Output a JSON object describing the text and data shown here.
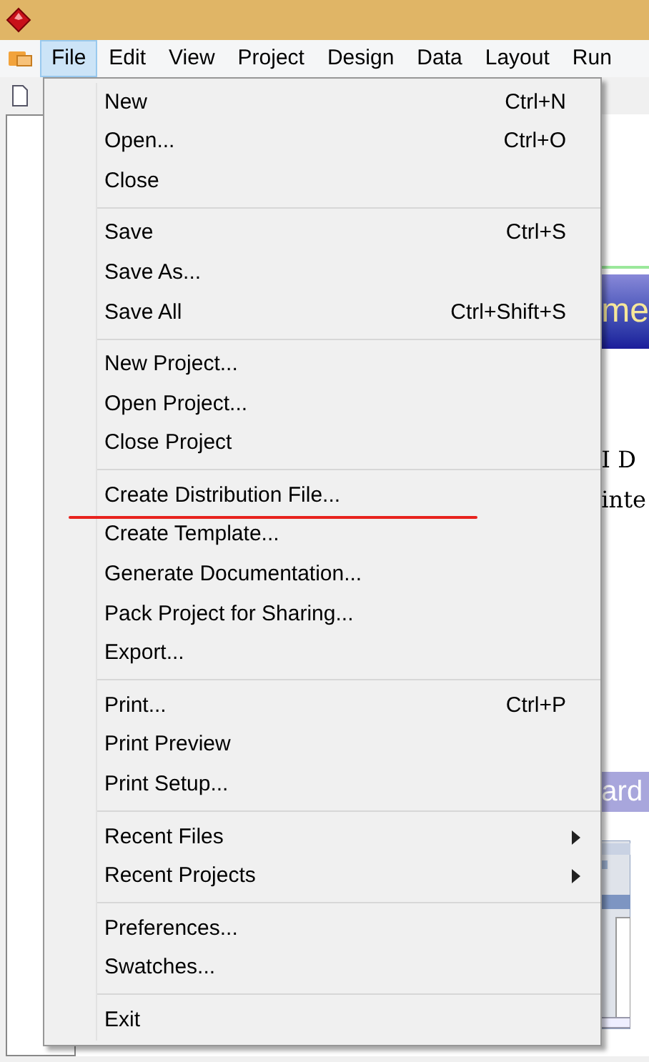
{
  "menubar": [
    {
      "label": "File",
      "selected": true
    },
    {
      "label": "Edit",
      "selected": false
    },
    {
      "label": "View",
      "selected": false
    },
    {
      "label": "Project",
      "selected": false
    },
    {
      "label": "Design",
      "selected": false
    },
    {
      "label": "Data",
      "selected": false
    },
    {
      "label": "Layout",
      "selected": false
    },
    {
      "label": "Run",
      "selected": false
    }
  ],
  "file_menu": [
    [
      {
        "label": "New",
        "shortcut": "Ctrl+N"
      },
      {
        "label": "Open...",
        "shortcut": "Ctrl+O"
      },
      {
        "label": "Close"
      }
    ],
    [
      {
        "label": "Save",
        "shortcut": "Ctrl+S"
      },
      {
        "label": "Save As..."
      },
      {
        "label": "Save All",
        "shortcut": "Ctrl+Shift+S"
      }
    ],
    [
      {
        "label": "New Project..."
      },
      {
        "label": "Open Project..."
      },
      {
        "label": "Close Project"
      }
    ],
    [
      {
        "label": "Create Distribution File...",
        "underlined": true
      },
      {
        "label": "Create Template..."
      },
      {
        "label": "Generate Documentation..."
      },
      {
        "label": "Pack Project for Sharing..."
      },
      {
        "label": "Export..."
      }
    ],
    [
      {
        "label": "Print...",
        "shortcut": "Ctrl+P"
      },
      {
        "label": "Print Preview"
      },
      {
        "label": "Print Setup..."
      }
    ],
    [
      {
        "label": "Recent Files",
        "submenu": true
      },
      {
        "label": "Recent Projects",
        "submenu": true
      }
    ],
    [
      {
        "label": "Preferences..."
      },
      {
        "label": "Swatches..."
      }
    ],
    [
      {
        "label": "Exit"
      }
    ]
  ],
  "document": {
    "banner_text": "me",
    "line_1": "I D",
    "line_2": "inte",
    "section_banner": "ard"
  }
}
